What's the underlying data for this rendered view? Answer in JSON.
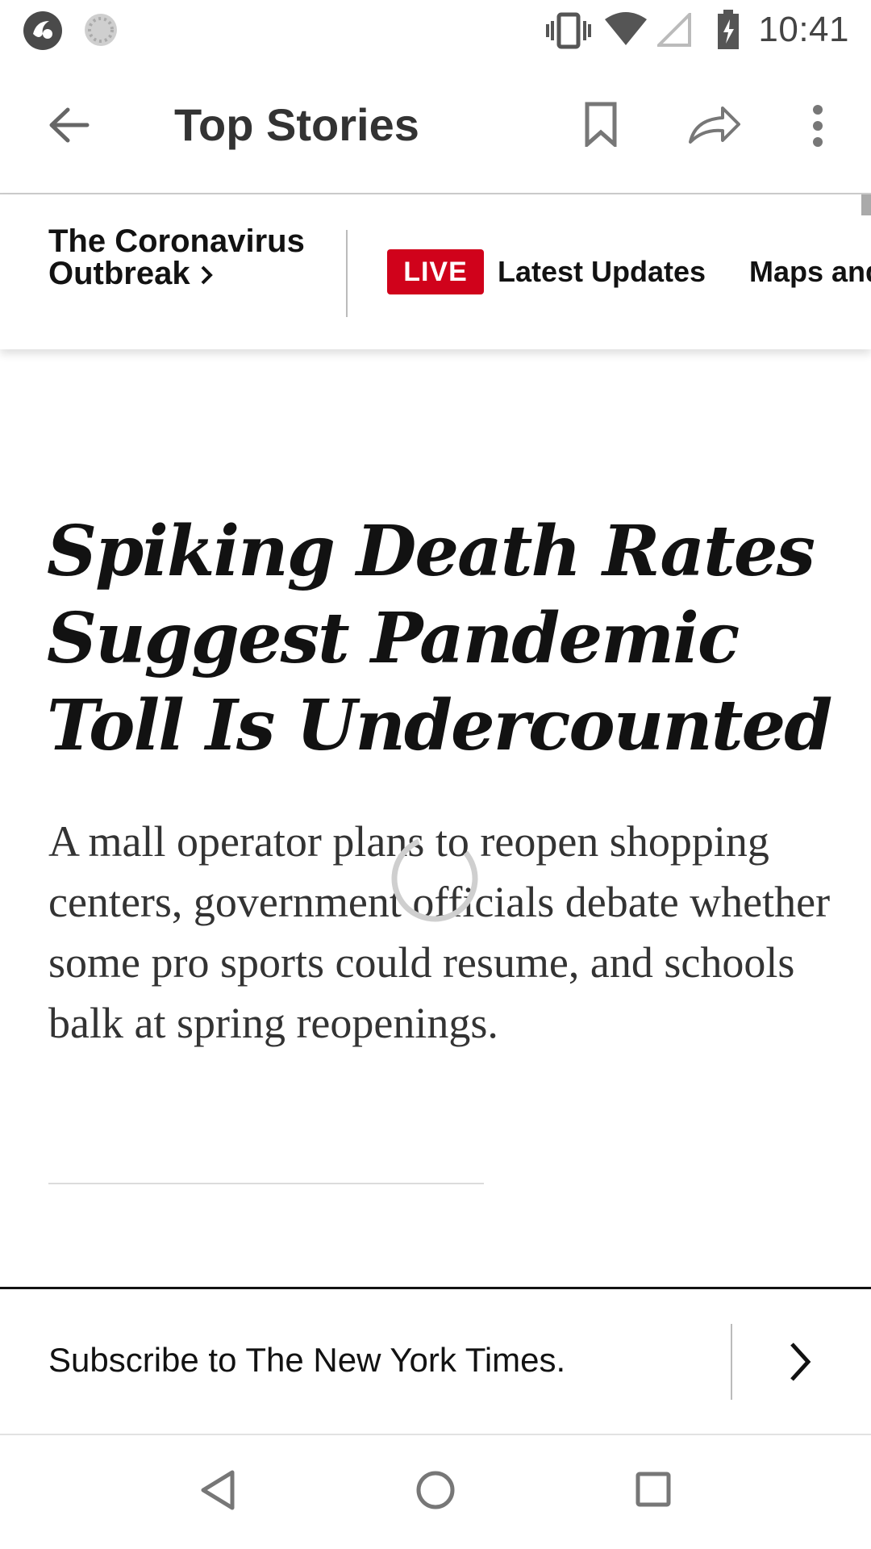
{
  "status_bar": {
    "time": "10:41",
    "left_icons": [
      "app-notification-icon",
      "loading-notification-icon"
    ],
    "right_icons": [
      "vibrate-icon",
      "wifi-icon",
      "cellular-signal-icon",
      "battery-charging-icon"
    ]
  },
  "toolbar": {
    "title": "Top Stories",
    "icons": [
      "back-arrow-icon",
      "bookmark-icon",
      "share-icon",
      "more-options-icon"
    ]
  },
  "section_nav": {
    "title_line1": "The Coronavirus",
    "title_line2": "Outbreak",
    "live_label": "LIVE",
    "links": [
      "Latest Updates",
      "Maps and"
    ]
  },
  "article": {
    "headline": "Spiking Death Rates Suggest Pandemic Toll Is Undercounted",
    "summary": "A mall operator plans to reopen shopping centers, government officials debate whether some pro sports could resume, and schools balk at spring reopenings."
  },
  "subscribe": {
    "text": "Subscribe to The New York Times."
  },
  "system_nav": {
    "buttons": [
      "back-nav-icon",
      "home-nav-icon",
      "recents-nav-icon"
    ]
  },
  "colors": {
    "live_red": "#d0021b",
    "text_primary": "#121212",
    "text_secondary": "#333333",
    "icon_gray": "#777777"
  }
}
